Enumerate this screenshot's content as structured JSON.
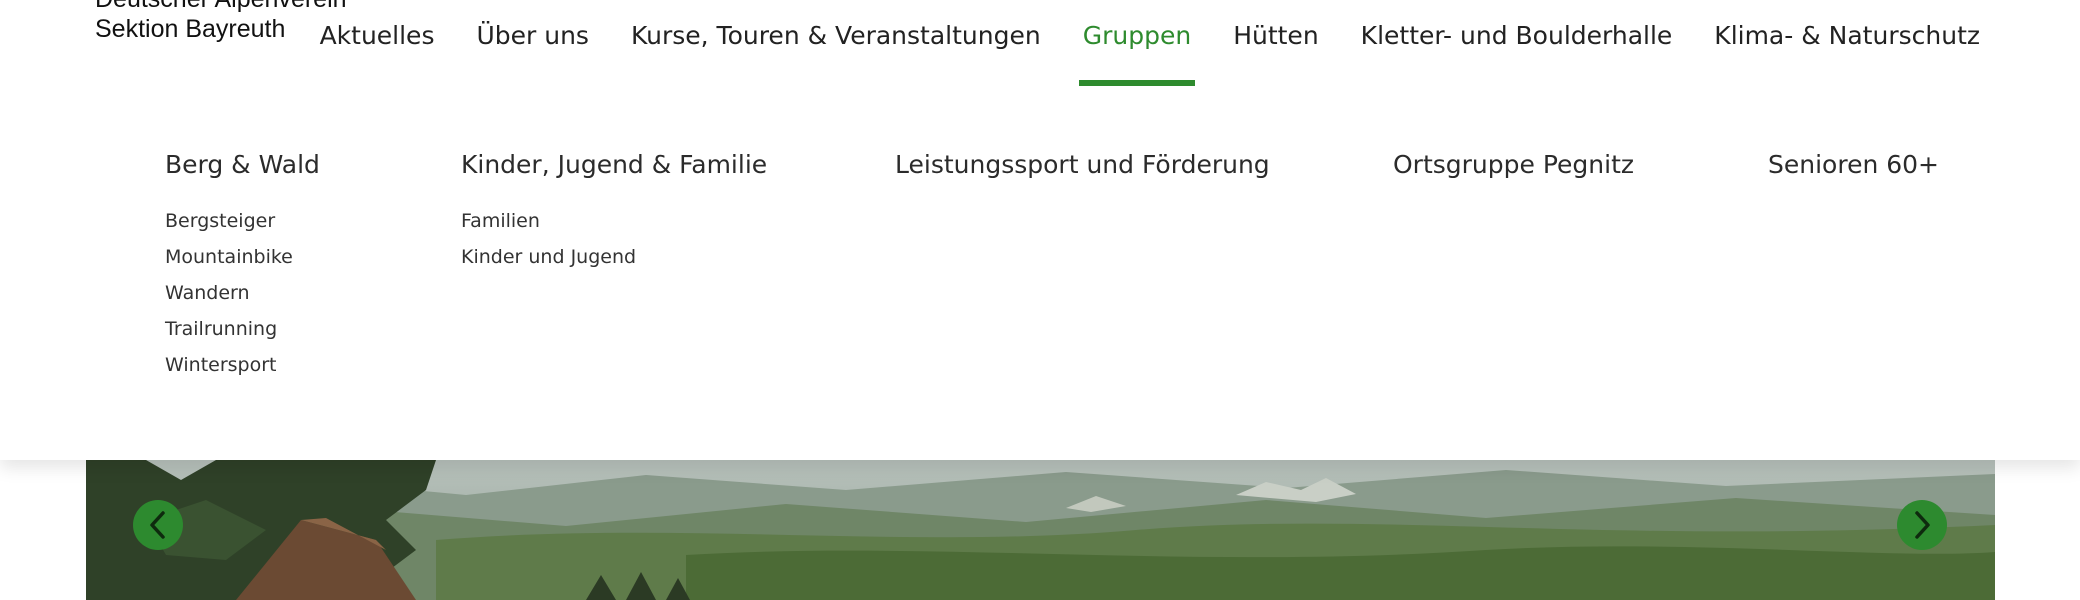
{
  "logo": {
    "line1": "Deutscher Alpenverein",
    "line2": "Sektion Bayreuth"
  },
  "nav": {
    "items": [
      {
        "label": "Aktuelles"
      },
      {
        "label": "Über uns"
      },
      {
        "label": "Kurse, Touren & Veranstaltungen"
      },
      {
        "label": "Gruppen",
        "active": true
      },
      {
        "label": "Hütten"
      },
      {
        "label": "Kletter- und Boulderhalle"
      },
      {
        "label": "Klima- & Naturschutz"
      }
    ]
  },
  "dropdown": {
    "columns": [
      {
        "heading": "Berg & Wald",
        "links": [
          "Bergsteiger",
          "Mountainbike",
          "Wandern",
          "Trailrunning",
          "Wintersport"
        ]
      },
      {
        "heading": "Kinder, Jugend & Familie",
        "links": [
          "Familien",
          "Kinder und Jugend"
        ]
      },
      {
        "heading": "Leistungssport und Förderung",
        "links": []
      },
      {
        "heading": "Ortsgruppe Pegnitz",
        "links": []
      },
      {
        "heading": "Senioren 60+",
        "links": []
      }
    ]
  },
  "slider": {
    "prev_icon": "chevron-left-icon",
    "next_icon": "chevron-right-icon"
  },
  "colors": {
    "accent": "#2e8b2e",
    "slider_button": "#2d8a2f"
  }
}
